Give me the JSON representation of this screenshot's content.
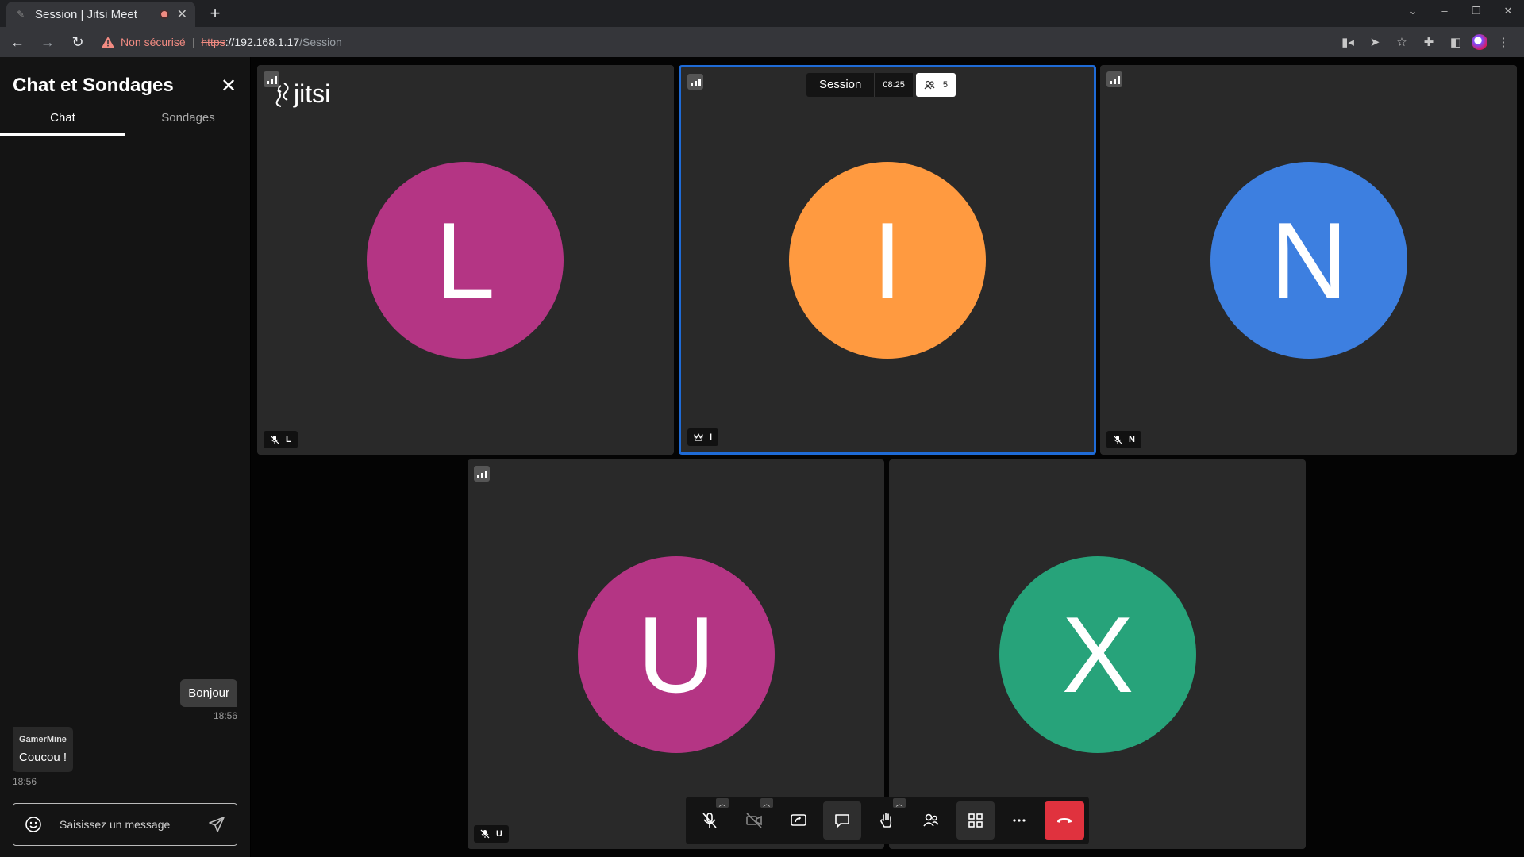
{
  "browser": {
    "tab_title": "Session | Jitsi Meet",
    "insecure_label": "Non sécurisé",
    "url_scheme": "https",
    "url_host": "://192.168.1.17",
    "url_path": "/Session"
  },
  "chat": {
    "title": "Chat et Sondages",
    "tabs": [
      {
        "label": "Chat"
      },
      {
        "label": "Sondages"
      }
    ],
    "messages": [
      {
        "author": "",
        "text": "Bonjour",
        "time": "18:56"
      },
      {
        "author": "GamerMine",
        "text": "Coucou !",
        "time": "18:56"
      }
    ],
    "input_placeholder": "Saisissez un message"
  },
  "meeting": {
    "brand": "jitsi",
    "name": "Session",
    "timer": "08:25",
    "participant_count": "5"
  },
  "participants": [
    {
      "letter": "L",
      "label": "L",
      "color": "#b43584"
    },
    {
      "letter": "I",
      "label": "I",
      "color": "#ff9a40"
    },
    {
      "letter": "N",
      "label": "N",
      "color": "#3d7fe0"
    },
    {
      "letter": "U",
      "label": "U",
      "color": "#b43584"
    },
    {
      "letter": "X",
      "label": "X",
      "color": "#27a37a"
    }
  ],
  "toolbar_icons": [
    "microphone-muted-icon",
    "camera-off-icon",
    "screen-share-icon",
    "chat-icon",
    "raise-hand-icon",
    "participants-icon",
    "tile-view-icon",
    "more-icon",
    "hangup-icon"
  ]
}
